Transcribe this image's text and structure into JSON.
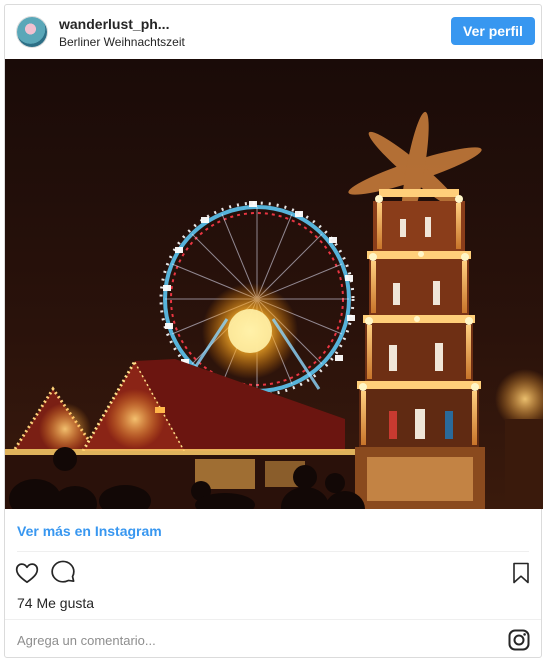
{
  "post": {
    "username": "wanderlust_ph...",
    "location": "Berliner Weihnachtszeit",
    "profile_button": "Ver perfil",
    "more_link": "Ver más en Instagram",
    "likes": "74 Me gusta",
    "comment_placeholder": "Agrega un comentario..."
  },
  "icons": {
    "like": "heart-icon",
    "comment": "comment-bubble-icon",
    "save": "bookmark-icon",
    "brand": "instagram-logo-icon"
  },
  "colors": {
    "accent": "#3897f0",
    "text": "#262626",
    "muted": "#8e8e8e",
    "border": "#dbdbdb"
  }
}
